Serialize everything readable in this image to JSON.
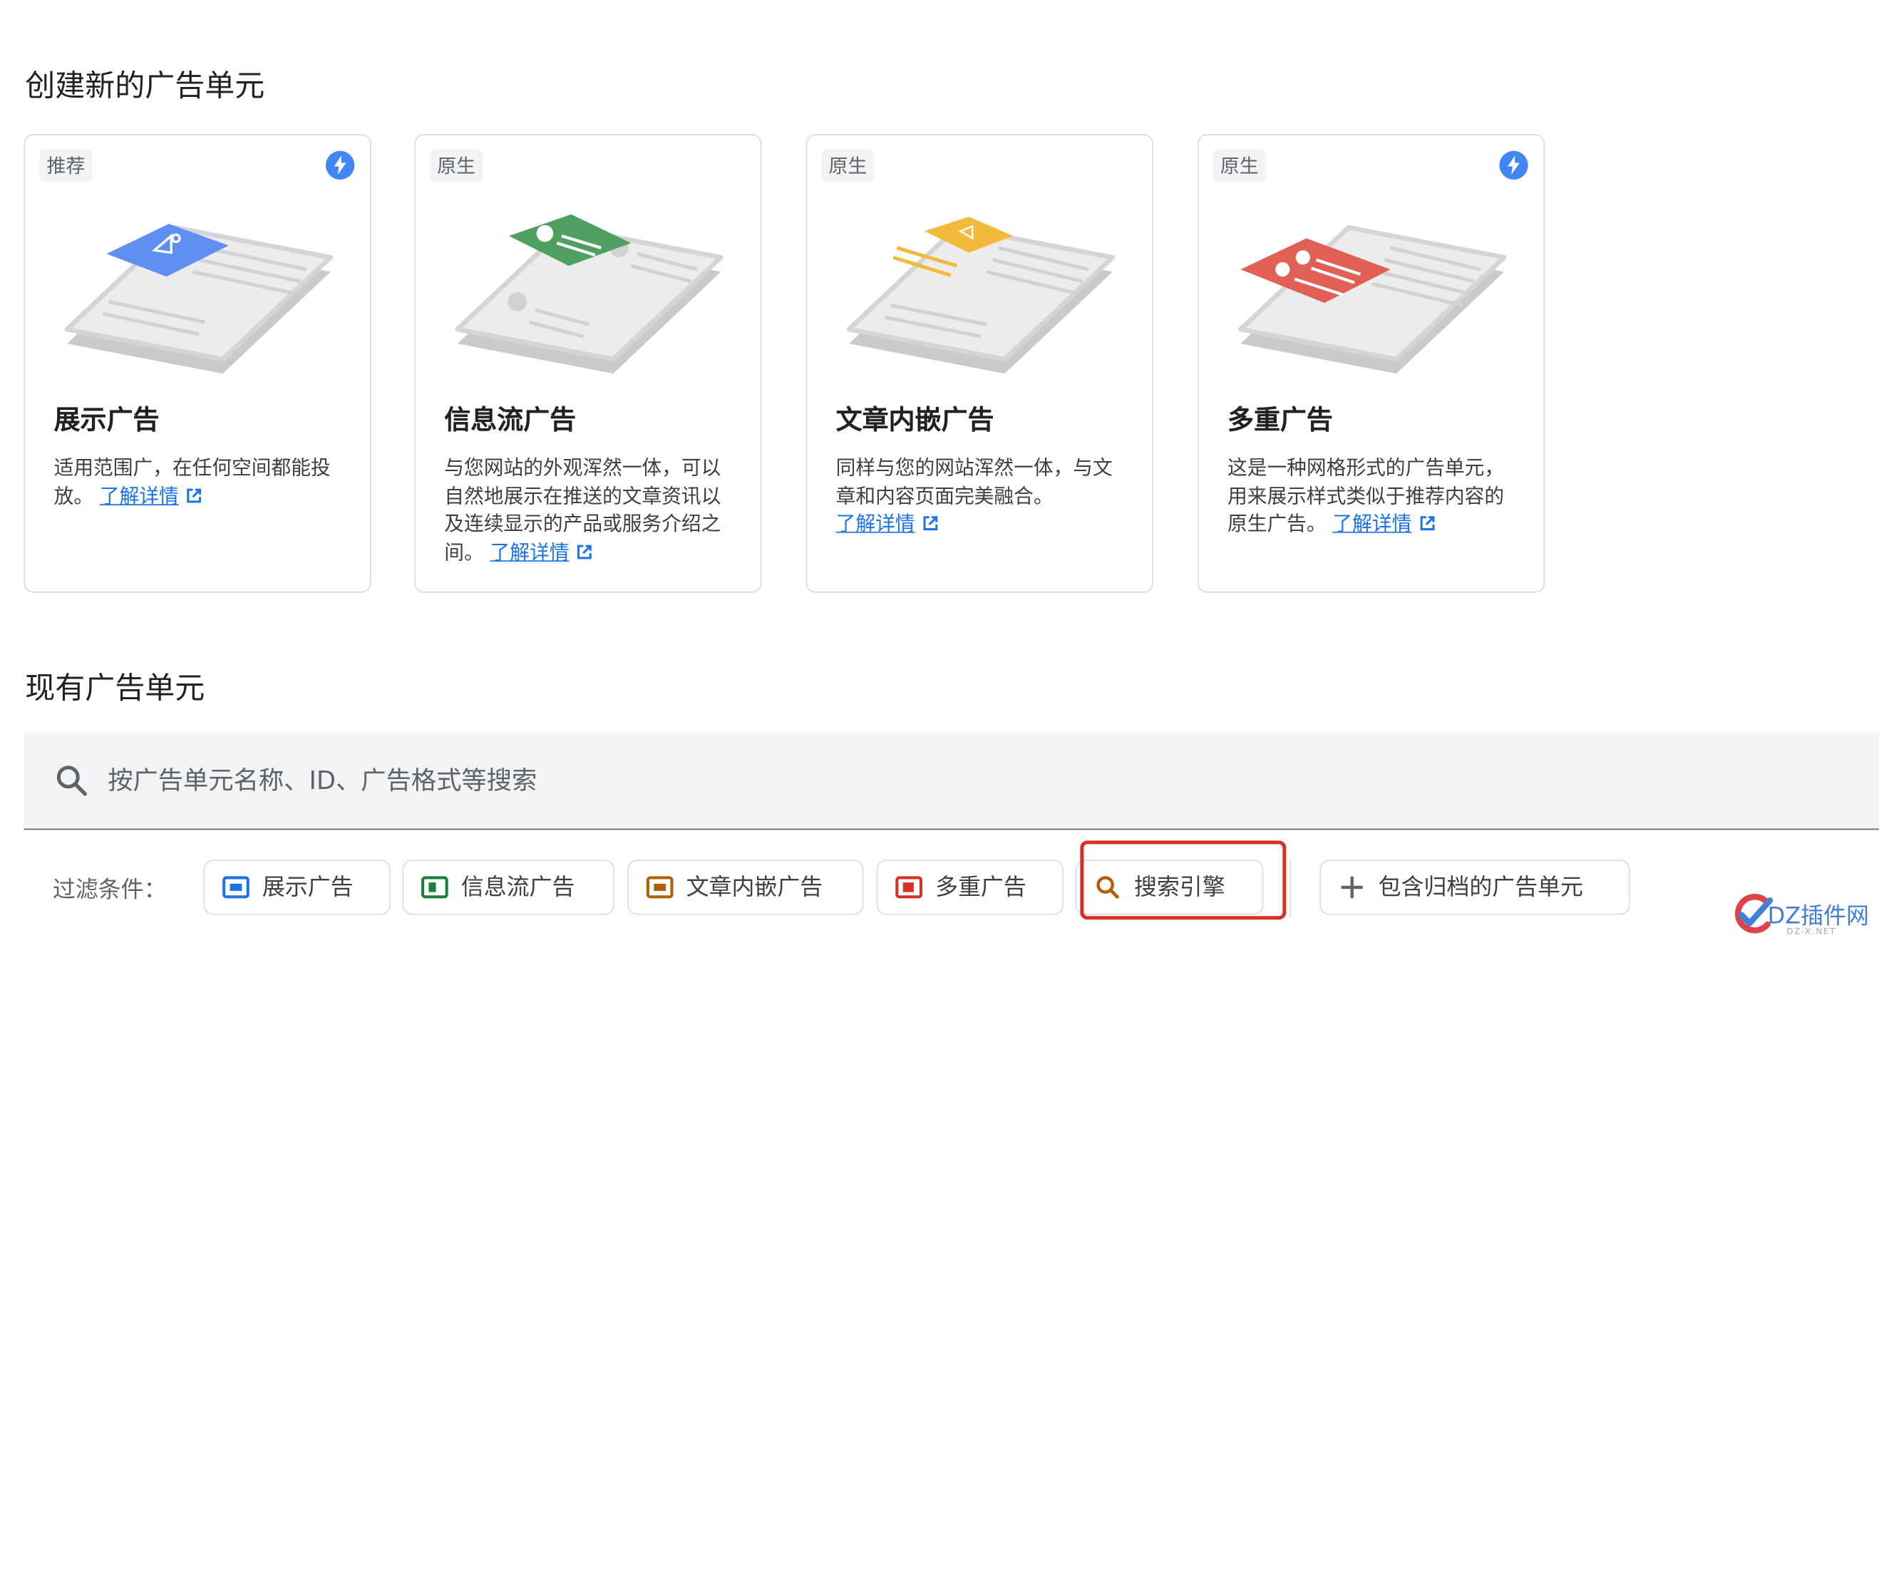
{
  "create_section": {
    "title": "创建新的广告单元"
  },
  "cards": [
    {
      "badge": "推荐",
      "has_bolt": true,
      "title": "展示广告",
      "desc": "适用范围广，在任何空间都能投放。",
      "link": "了解详情",
      "accent": "#5f8ff0"
    },
    {
      "badge": "原生",
      "has_bolt": false,
      "title": "信息流广告",
      "desc": "与您网站的外观浑然一体，可以自然地展示在推送的文章资讯以及连续显示的产品或服务介绍之间。",
      "link": "了解详情",
      "accent": "#4e9f60"
    },
    {
      "badge": "原生",
      "has_bolt": false,
      "title": "文章内嵌广告",
      "desc": "同样与您的网站浑然一体，与文章和内容页面完美融合。",
      "link": "了解详情",
      "accent": "#f3b93a"
    },
    {
      "badge": "原生",
      "has_bolt": true,
      "title": "多重广告",
      "desc": "这是一种网格形式的广告单元，用来展示样式类似于推荐内容的原生广告。",
      "link": "了解详情",
      "accent": "#e06055"
    }
  ],
  "existing_section": {
    "title": "现有广告单元"
  },
  "search": {
    "placeholder": "按广告单元名称、ID、广告格式等搜索",
    "icon": "search-icon"
  },
  "filters": {
    "label": "过滤条件：",
    "chips": [
      {
        "label": "展示广告",
        "icon": "display-ad-icon",
        "color": "#1a73e8"
      },
      {
        "label": "信息流广告",
        "icon": "in-feed-ad-icon",
        "color": "#188038"
      },
      {
        "label": "文章内嵌广告",
        "icon": "in-article-ad-icon",
        "color": "#b06000"
      },
      {
        "label": "多重广告",
        "icon": "multiplex-ad-icon",
        "color": "#d93025"
      },
      {
        "label": "搜索引擎",
        "icon": "search-icon",
        "color": "#b06000"
      },
      {
        "label": "包含归档的广告单元",
        "icon": "plus-icon",
        "color": "#5f6368"
      }
    ]
  },
  "watermark": {
    "text": "DZ插件网",
    "sub": "DZ-X.NET"
  }
}
